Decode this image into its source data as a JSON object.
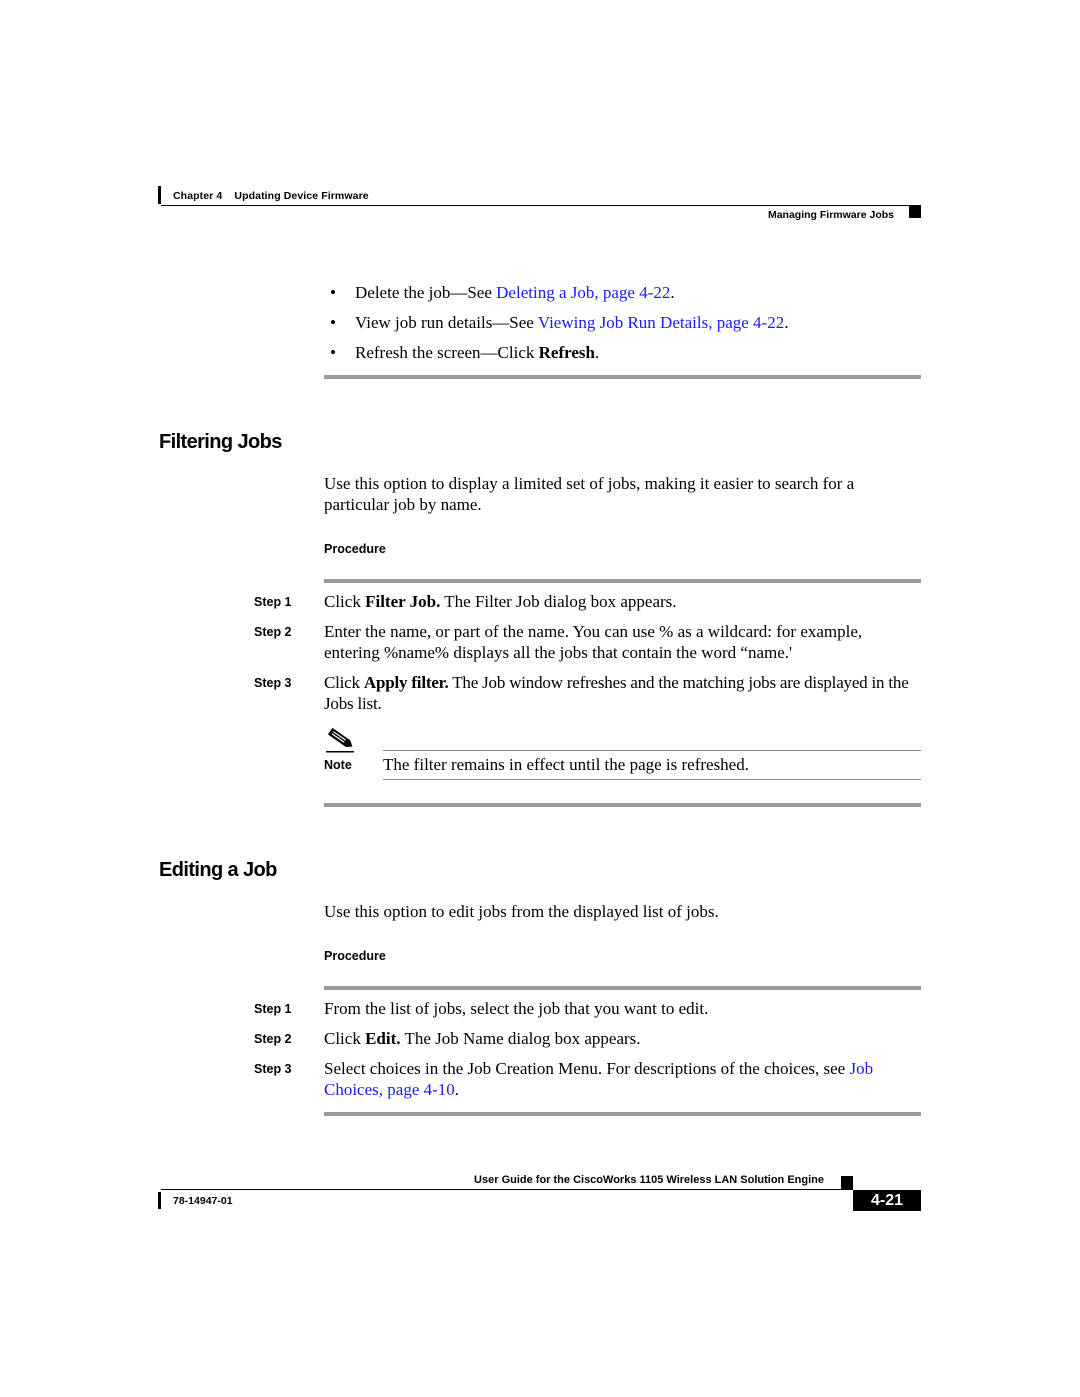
{
  "header": {
    "chapter": "Chapter 4",
    "chapter_title": "Updating Device Firmware",
    "section": "Managing Firmware Jobs"
  },
  "intro_bullets": [
    {
      "prefix": "Delete the job—See ",
      "link": "Deleting a Job, page 4-22",
      "suffix": "."
    },
    {
      "prefix": "View job run details—See ",
      "link": "Viewing Job Run Details, page 4-22",
      "suffix": "."
    },
    {
      "prefix": "Refresh the screen—Click ",
      "bold": "Refresh",
      "suffix": "."
    }
  ],
  "bullet_glyph": "•",
  "filtering": {
    "title": "Filtering Jobs",
    "description": "Use this option to display a limited set of jobs, making it easier to search for a particular job by name.",
    "procedure_label": "Procedure",
    "steps": [
      {
        "label": "Step 1",
        "pre": "Click ",
        "bold": "Filter Job.",
        "post": " The Filter Job dialog box appears."
      },
      {
        "label": "Step 2",
        "pre": "Enter the name, or part of the name. You can use % as a wildcard: for example, entering %name% displays all the jobs that contain the word “name.'",
        "bold": "",
        "post": ""
      },
      {
        "label": "Step 3",
        "pre": "Click ",
        "bold": "Apply filter.",
        "post": " The Job window refreshes and the matching jobs are displayed in the Jobs list."
      }
    ],
    "note": {
      "label": "Note",
      "icon": "pencil-note-icon",
      "text": "The filter remains in effect until the page is refreshed."
    }
  },
  "editing": {
    "title": "Editing a Job",
    "description": "Use this option to edit jobs from the displayed list of jobs.",
    "procedure_label": "Procedure",
    "steps": [
      {
        "label": "Step 1",
        "pre": "From the list of jobs, select the job that you want to edit.",
        "bold": "",
        "post": ""
      },
      {
        "label": "Step 2",
        "pre": "Click ",
        "bold": "Edit.",
        "post": " The Job Name dialog box appears."
      },
      {
        "label": "Step 3",
        "pre": "Select choices in the Job Creation Menu. For descriptions of the choices, see ",
        "link": "Job Choices, page 4-10",
        "post": "."
      }
    ]
  },
  "footer": {
    "guide_title": "User Guide for the CiscoWorks 1105 Wireless LAN Solution Engine",
    "doc_number": "78-14947-01",
    "page_number": "4-21"
  },
  "colors": {
    "link": "#1a1aff",
    "rule": "#9a9a9a",
    "text": "#000000"
  }
}
